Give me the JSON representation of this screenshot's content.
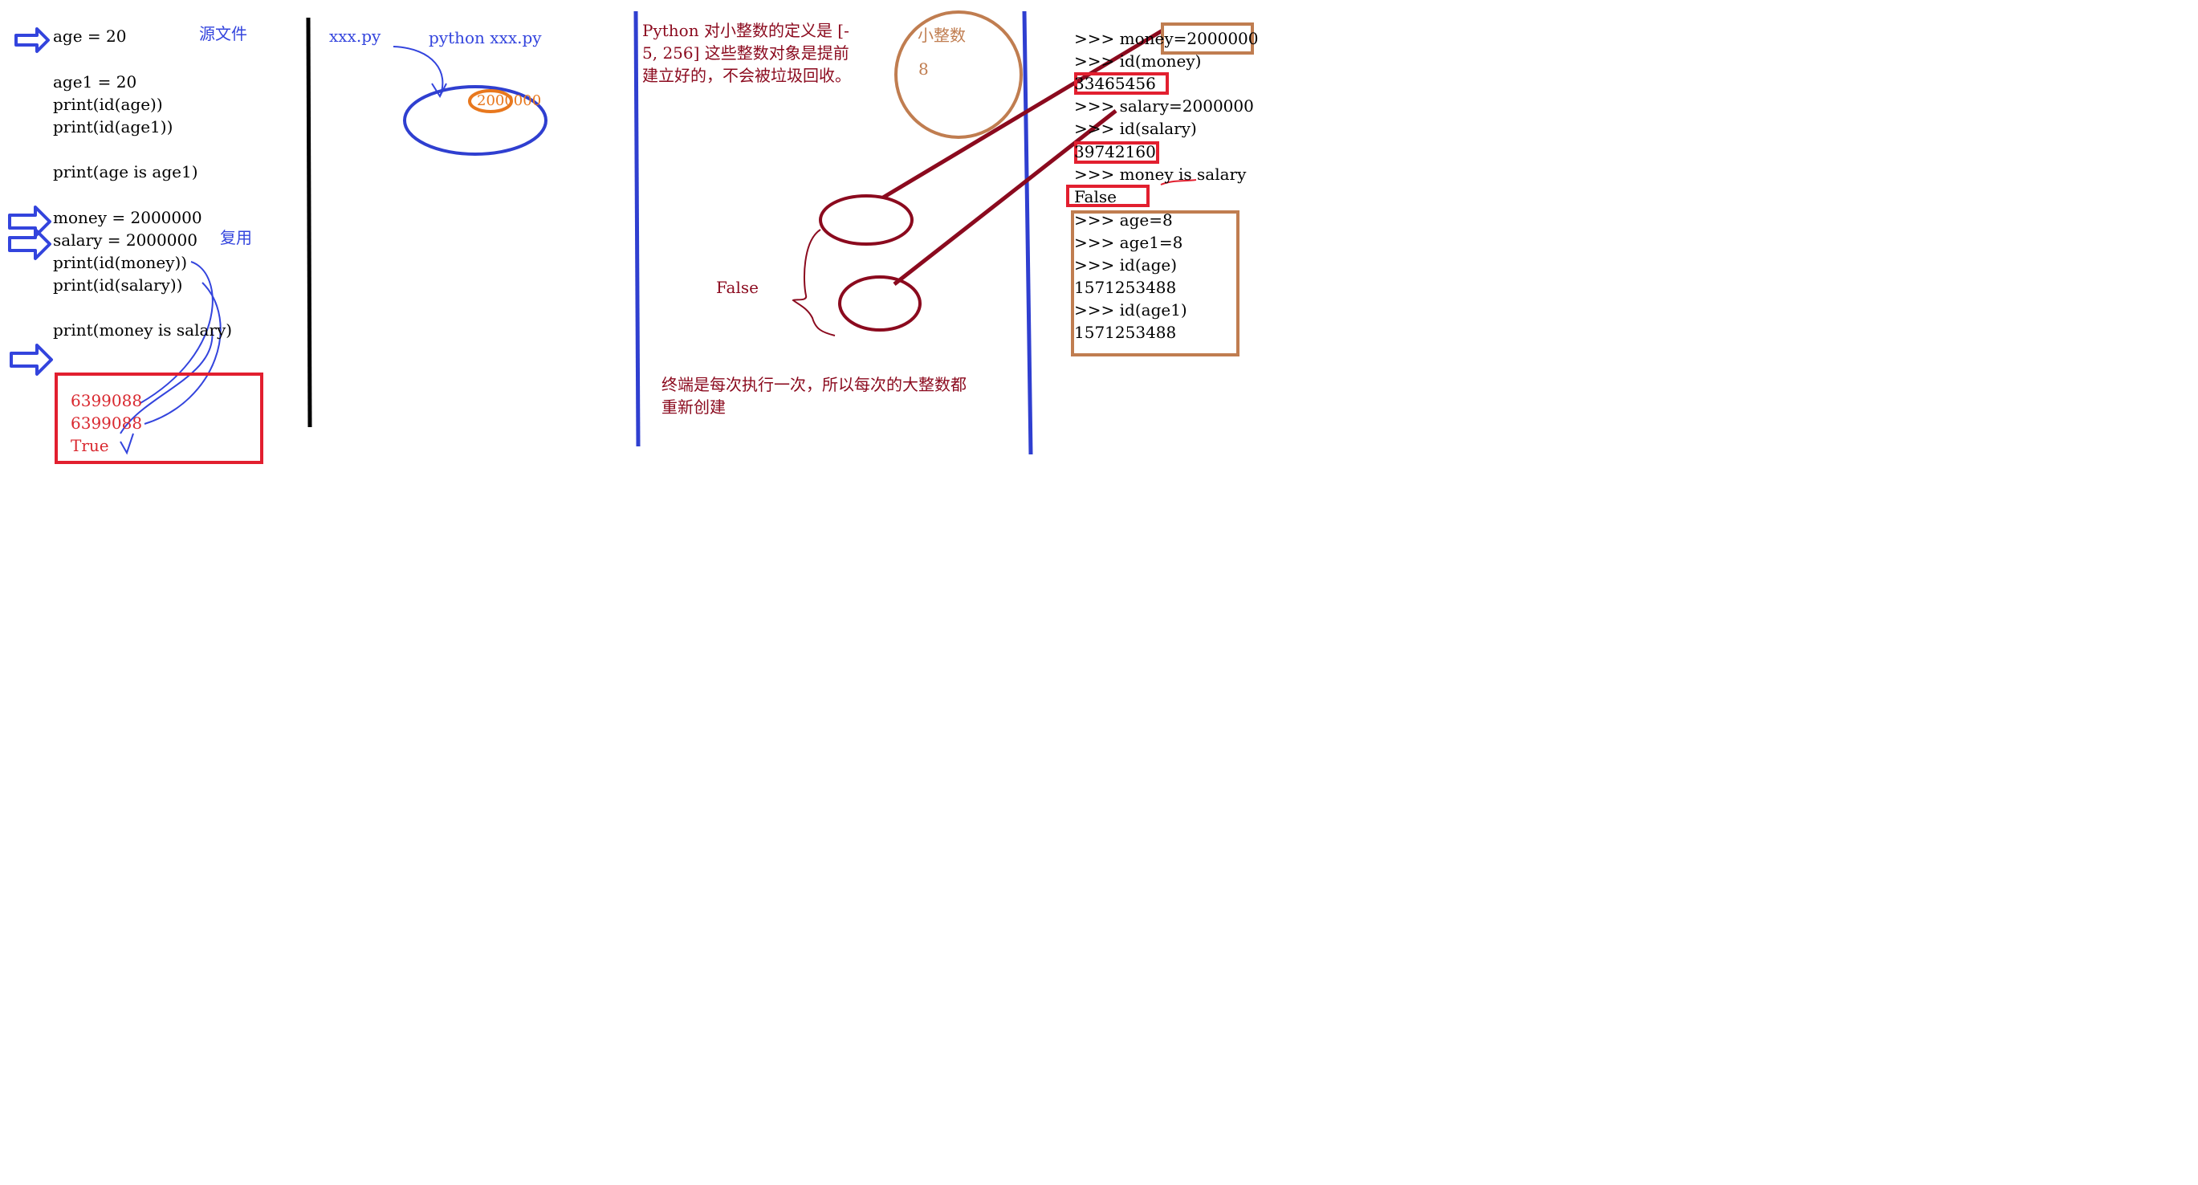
{
  "colors": {
    "code": "#000000",
    "blue_annotation": "#3344dd",
    "red_box": "#e21f2f",
    "dark_red": "#8b0a1e",
    "brown_box": "#c07d50",
    "orange": "#e8781e",
    "divider_black": "#000000",
    "divider_blue": "#2f3fd0"
  },
  "source": {
    "label": "源文件",
    "reuse_label": "复用",
    "lines": {
      "l1": "age = 20",
      "l2": "age1 = 20",
      "l3": "print(id(age))",
      "l4": "print(id(age1))",
      "l5": "print(age is age1)",
      "l6": "money = 2000000",
      "l7": "salary = 2000000",
      "l8": "print(id(money))",
      "l9": "print(id(salary))",
      "l10": "print(money is salary)"
    },
    "output": [
      "6399088",
      "6399088",
      "True"
    ]
  },
  "run": {
    "file_label": "xxx.py",
    "command_label": "python xxx.py",
    "object_value": "2000000"
  },
  "explain": {
    "note_line1": "Python 对小整数的定义是 [-",
    "note_line2": "5, 256] 这些整数对象是提前",
    "note_line3": "建立好的，不会被垃圾回收。",
    "small_int_label": "小整数",
    "small_int_value": "8",
    "false_label": "False",
    "terminal_note_line1": "终端是每次执行一次，所以每次的大整数都",
    "terminal_note_line2": "重新创建"
  },
  "terminal": {
    "prompt": ">>>",
    "cmd1": "money=2000000",
    "cmd2": "id(money)",
    "out2": "33465456",
    "cmd3": "salary=2000000",
    "cmd4": "id(salary)",
    "out4": "39742160",
    "cmd5": "money is salary",
    "out5": "False",
    "cmd6": "age=8",
    "cmd7": "age1=8",
    "cmd8": "id(age)",
    "out8": "1571253488",
    "cmd9": "id(age1)",
    "out9": "1571253488"
  }
}
